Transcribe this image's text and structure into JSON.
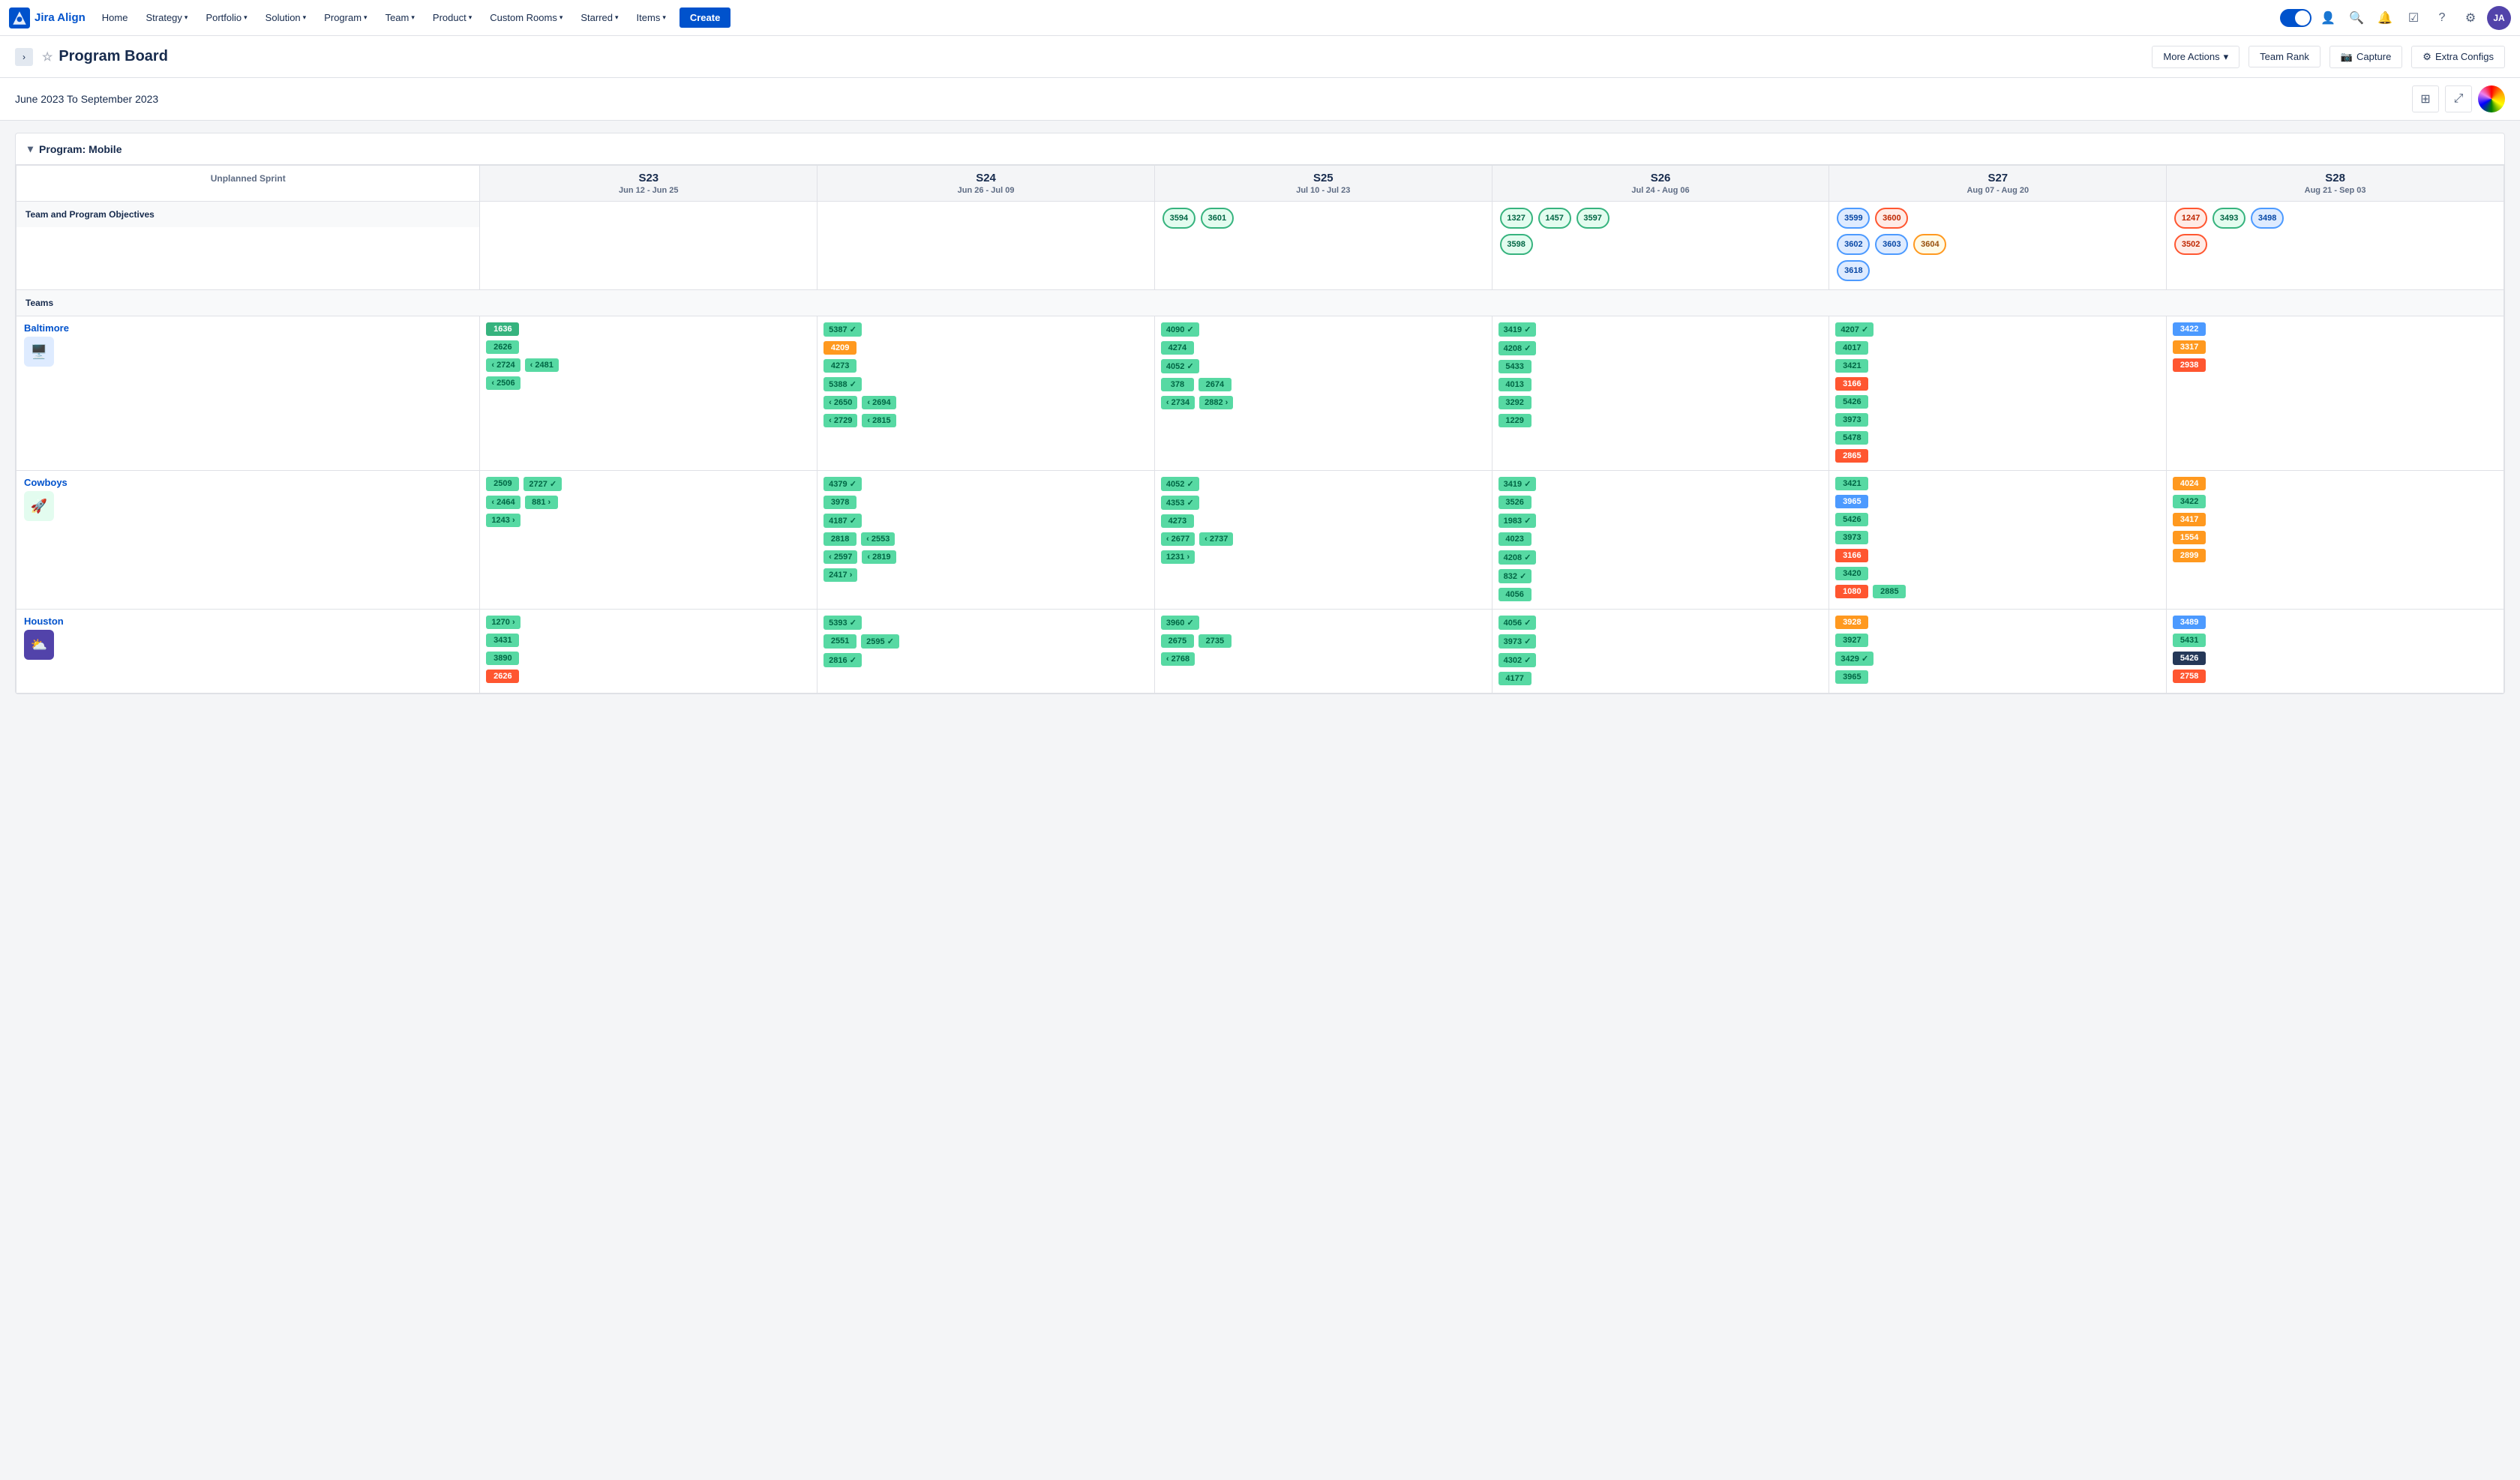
{
  "nav": {
    "logo_text": "Jira Align",
    "items": [
      {
        "label": "Home",
        "has_chevron": false
      },
      {
        "label": "Strategy",
        "has_chevron": true
      },
      {
        "label": "Portfolio",
        "has_chevron": true
      },
      {
        "label": "Solution",
        "has_chevron": true
      },
      {
        "label": "Program",
        "has_chevron": true
      },
      {
        "label": "Team",
        "has_chevron": true
      },
      {
        "label": "Product",
        "has_chevron": true
      },
      {
        "label": "Custom Rooms",
        "has_chevron": true
      },
      {
        "label": "Starred",
        "has_chevron": true
      },
      {
        "label": "Items",
        "has_chevron": true
      }
    ],
    "create_label": "Create"
  },
  "page": {
    "title": "Program Board",
    "star_symbol": "☆",
    "more_actions_label": "More Actions",
    "team_rank_label": "Team Rank",
    "capture_label": "Capture",
    "extra_configs_label": "Extra Configs"
  },
  "board": {
    "date_range": "June 2023 To September 2023",
    "program_label": "Program: Mobile",
    "unplanned_sprint_label": "Unplanned Sprint",
    "sections": {
      "objectives_label": "Team and Program Objectives",
      "teams_label": "Teams"
    },
    "sprints": [
      {
        "name": "S23",
        "dates": "Jun 12 - Jun 25"
      },
      {
        "name": "S24",
        "dates": "Jun 26 - Jul 09"
      },
      {
        "name": "S25",
        "dates": "Jul 10 - Jul 23"
      },
      {
        "name": "S26",
        "dates": "Jul 24 - Aug 06"
      },
      {
        "name": "S27",
        "dates": "Aug 07 - Aug 20"
      },
      {
        "name": "S28",
        "dates": "Aug 21 - Sep 03"
      }
    ],
    "objectives": {
      "s23": [],
      "s24": [],
      "s25": [
        {
          "id": "3594",
          "color": "green"
        },
        {
          "id": "3601",
          "color": "green"
        }
      ],
      "s26": [
        {
          "id": "1327",
          "color": "green"
        },
        {
          "id": "1457",
          "color": "green"
        },
        {
          "id": "3597",
          "color": "green"
        },
        {
          "id": "3598",
          "color": "green"
        }
      ],
      "s27": [
        {
          "id": "3599",
          "color": "blue"
        },
        {
          "id": "3600",
          "color": "red"
        },
        {
          "id": "3602",
          "color": "blue"
        },
        {
          "id": "3603",
          "color": "blue"
        },
        {
          "id": "3604",
          "color": "orange"
        },
        {
          "id": "3618",
          "color": "blue"
        }
      ],
      "s28": [
        {
          "id": "1247",
          "color": "red"
        },
        {
          "id": "3493",
          "color": "green"
        },
        {
          "id": "3498",
          "color": "blue"
        },
        {
          "id": "3502",
          "color": "red"
        }
      ]
    },
    "teams": [
      {
        "name": "Baltimore",
        "icon_color": "#0052cc",
        "icon_bg": "#deebff",
        "icon": "🖥",
        "cards": {
          "s23": [
            {
              "id": "1636",
              "color": "green-dark"
            },
            {
              "id": "2626",
              "color": "green"
            },
            {
              "id": "2724",
              "color": "green",
              "arrow": "left"
            },
            {
              "id": "2481",
              "color": "green",
              "arrow": "left"
            },
            {
              "id": "2506",
              "color": "green",
              "arrow": "left"
            }
          ],
          "s24": [
            {
              "id": "5387",
              "color": "green",
              "check": true
            },
            {
              "id": "4209",
              "color": "orange"
            },
            {
              "id": "4273",
              "color": "green"
            },
            {
              "id": "5388",
              "color": "green",
              "check": true
            },
            {
              "id": "2650",
              "color": "green",
              "arrow": "left"
            },
            {
              "id": "2694",
              "color": "green",
              "arrow": "left"
            },
            {
              "id": "2729",
              "color": "green",
              "arrow": "left"
            },
            {
              "id": "2815",
              "color": "green",
              "arrow": "left"
            }
          ],
          "s25": [
            {
              "id": "4090",
              "color": "green",
              "check": true
            },
            {
              "id": "4274",
              "color": "green"
            },
            {
              "id": "4052",
              "color": "green",
              "check": true
            },
            {
              "id": "378",
              "color": "green"
            },
            {
              "id": "2674",
              "color": "green"
            },
            {
              "id": "2734",
              "color": "green",
              "arrow": "left"
            },
            {
              "id": "2882",
              "color": "green",
              "arrow": "right"
            }
          ],
          "s26": [
            {
              "id": "3419",
              "color": "green",
              "check": true
            },
            {
              "id": "4208",
              "color": "green",
              "check": true
            },
            {
              "id": "5433",
              "color": "green"
            },
            {
              "id": "4013",
              "color": "green"
            },
            {
              "id": "3292",
              "color": "green"
            },
            {
              "id": "1229",
              "color": "green"
            }
          ],
          "s27": [
            {
              "id": "4207",
              "color": "green",
              "check": true
            },
            {
              "id": "4017",
              "color": "green"
            },
            {
              "id": "3421",
              "color": "green"
            },
            {
              "id": "3166",
              "color": "red"
            },
            {
              "id": "5426",
              "color": "green"
            },
            {
              "id": "3973",
              "color": "green"
            },
            {
              "id": "5478",
              "color": "green"
            },
            {
              "id": "2865",
              "color": "red"
            }
          ],
          "s28": [
            {
              "id": "3422",
              "color": "blue-light"
            },
            {
              "id": "3317",
              "color": "orange"
            },
            {
              "id": "2938",
              "color": "red"
            }
          ]
        }
      },
      {
        "name": "Cowboys",
        "icon_color": "#0052cc",
        "icon_bg": "#e3fcef",
        "icon": "🚀",
        "cards": {
          "s23": [
            {
              "id": "2509",
              "color": "green"
            },
            {
              "id": "2727",
              "color": "green",
              "check": true
            },
            {
              "id": "2464",
              "color": "green",
              "arrow": "left"
            },
            {
              "id": "881",
              "color": "green",
              "arrow": "right"
            },
            {
              "id": "1243",
              "color": "green",
              "arrow": "right"
            }
          ],
          "s24": [
            {
              "id": "4379",
              "color": "green",
              "check": true
            },
            {
              "id": "3978",
              "color": "green"
            },
            {
              "id": "4187",
              "color": "green",
              "check": true
            },
            {
              "id": "2818",
              "color": "green"
            },
            {
              "id": "2553",
              "color": "green",
              "arrow": "left"
            },
            {
              "id": "2597",
              "color": "green",
              "arrow": "left"
            },
            {
              "id": "2819",
              "color": "green",
              "arrow": "left"
            },
            {
              "id": "2417",
              "color": "green",
              "arrow": "right"
            }
          ],
          "s25": [
            {
              "id": "4052",
              "color": "green",
              "check": true
            },
            {
              "id": "4353",
              "color": "green",
              "check": true
            },
            {
              "id": "4273",
              "color": "green"
            },
            {
              "id": "2677",
              "color": "green",
              "arrow": "left"
            },
            {
              "id": "2737",
              "color": "green",
              "arrow": "left"
            },
            {
              "id": "1231",
              "color": "green",
              "arrow": "right"
            }
          ],
          "s26": [
            {
              "id": "3419",
              "color": "green",
              "check": true
            },
            {
              "id": "3526",
              "color": "green"
            },
            {
              "id": "1983",
              "color": "green",
              "check": true
            },
            {
              "id": "4023",
              "color": "green"
            },
            {
              "id": "4208",
              "color": "green",
              "check": true
            },
            {
              "id": "832",
              "color": "green",
              "check": true
            },
            {
              "id": "4056",
              "color": "green"
            }
          ],
          "s27": [
            {
              "id": "3421",
              "color": "green"
            },
            {
              "id": "3965",
              "color": "blue-light"
            },
            {
              "id": "5426",
              "color": "green"
            },
            {
              "id": "3973",
              "color": "green"
            },
            {
              "id": "3166",
              "color": "red"
            },
            {
              "id": "3420",
              "color": "green"
            },
            {
              "id": "1080",
              "color": "red"
            },
            {
              "id": "2885",
              "color": "green"
            }
          ],
          "s28": [
            {
              "id": "4024",
              "color": "orange"
            },
            {
              "id": "3422",
              "color": "green"
            },
            {
              "id": "3417",
              "color": "orange"
            },
            {
              "id": "1554",
              "color": "orange"
            },
            {
              "id": "2899",
              "color": "orange"
            }
          ]
        }
      },
      {
        "name": "Houston",
        "icon_color": "#0052cc",
        "icon_bg": "#5243aa",
        "icon": "⛅",
        "cards": {
          "s23": [
            {
              "id": "1270",
              "color": "green",
              "arrow": "right"
            },
            {
              "id": "3431",
              "color": "green"
            },
            {
              "id": "3890",
              "color": "green"
            },
            {
              "id": "2626",
              "color": "red"
            }
          ],
          "s24": [
            {
              "id": "5393",
              "color": "green",
              "check": true
            },
            {
              "id": "2551",
              "color": "green"
            },
            {
              "id": "2595",
              "color": "green",
              "check": true
            },
            {
              "id": "2816",
              "color": "green",
              "check": true
            }
          ],
          "s25": [
            {
              "id": "3960",
              "color": "green",
              "check": true
            },
            {
              "id": "2675",
              "color": "green"
            },
            {
              "id": "2735",
              "color": "green"
            },
            {
              "id": "2768",
              "color": "green",
              "arrow": "left"
            }
          ],
          "s26": [
            {
              "id": "4056",
              "color": "green",
              "check": true
            },
            {
              "id": "3973",
              "color": "green",
              "check": true
            },
            {
              "id": "4302",
              "color": "green",
              "check": true
            },
            {
              "id": "4177",
              "color": "green"
            }
          ],
          "s27": [
            {
              "id": "3928",
              "color": "orange"
            },
            {
              "id": "3927",
              "color": "green"
            },
            {
              "id": "3429",
              "color": "green",
              "check": true
            },
            {
              "id": "3965",
              "color": "green"
            }
          ],
          "s28": [
            {
              "id": "3489",
              "color": "blue-light"
            },
            {
              "id": "5431",
              "color": "green"
            },
            {
              "id": "5426",
              "color": "dark"
            },
            {
              "id": "2758",
              "color": "red"
            }
          ]
        }
      }
    ]
  }
}
